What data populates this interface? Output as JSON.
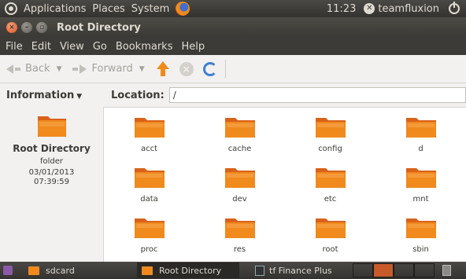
{
  "top_panel": {
    "menus": [
      "Applications",
      "Places",
      "System"
    ],
    "clock": "11:23",
    "username": "teamfluxion"
  },
  "window": {
    "title": "Root Directory"
  },
  "menubar": [
    "File",
    "Edit",
    "View",
    "Go",
    "Bookmarks",
    "Help"
  ],
  "toolbar": {
    "back_label": "Back",
    "forward_label": "Forward"
  },
  "sidebar": {
    "header": "Information",
    "name": "Root Directory",
    "type": "folder",
    "date": "03/01/2013",
    "time": "07:39:59"
  },
  "location": {
    "label": "Location:",
    "value": "/"
  },
  "folders": [
    "acct",
    "cache",
    "config",
    "d",
    "data",
    "dev",
    "etc",
    "mnt",
    "proc",
    "res",
    "root",
    "sbin"
  ],
  "taskbar": {
    "tasks": [
      "sdcard",
      "Root Directory",
      "tf Finance Plus"
    ]
  },
  "colors": {
    "folder": "#f08a1d",
    "panel": "#3c3b37"
  }
}
